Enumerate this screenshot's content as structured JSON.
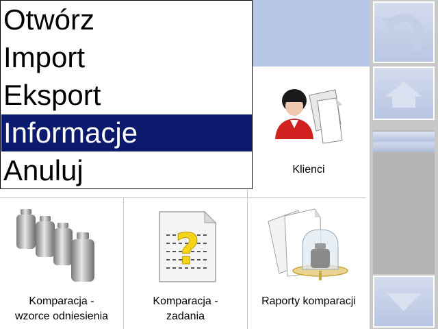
{
  "menu": {
    "items": [
      {
        "label": "Otwórz"
      },
      {
        "label": "Import"
      },
      {
        "label": "Eksport"
      },
      {
        "label": "Informacje",
        "selected": true
      },
      {
        "label": "Anuluj"
      }
    ]
  },
  "tiles": {
    "clients": {
      "label": "Klienci",
      "icon": "client-person-icon"
    },
    "reference_standards": {
      "line1": "Komparacja -",
      "line2": "wzorce odniesienia",
      "icon": "weights-icon"
    },
    "tasks": {
      "line1": "Komparacja -",
      "line2": "zadania",
      "icon": "task-document-question-icon"
    },
    "reports": {
      "label": "Raporty komparacji",
      "icon": "report-balance-icon"
    }
  },
  "side": {
    "back_icon": "undo-arrow-icon",
    "home_icon": "home-icon",
    "down_icon": "arrow-down-icon"
  },
  "colors": {
    "header": "#b6c6e6",
    "selected": "#0c1a6e",
    "panel": "#c8c8c8"
  }
}
